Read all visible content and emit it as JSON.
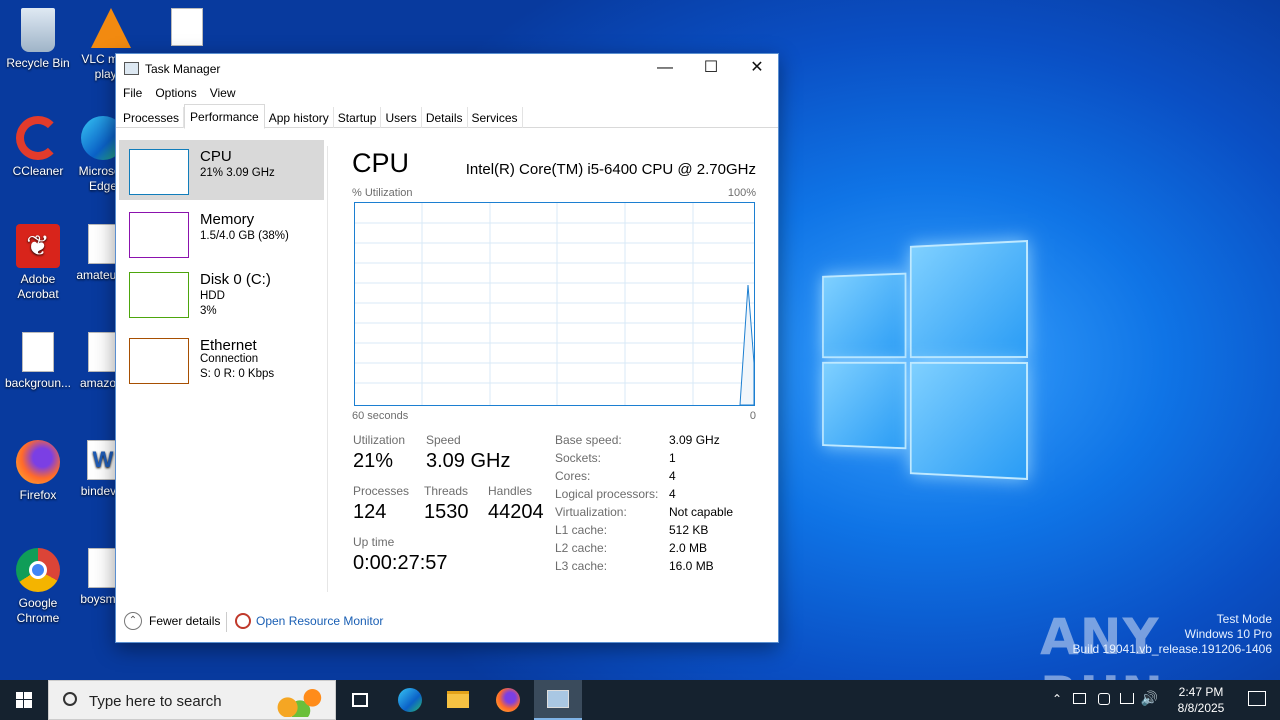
{
  "desktop": {
    "icons": [
      {
        "label": "Recycle Bin",
        "icon": "recycle-bin-icon"
      },
      {
        "label": "VLC media player",
        "icon": "vlc-icon"
      },
      {
        "label": "CCleaner",
        "icon": "ccleaner-icon"
      },
      {
        "label": "Microsoft Edge",
        "icon": "edge-icon"
      },
      {
        "label": "Adobe Acrobat",
        "icon": "acrobat-icon"
      },
      {
        "label": "amateur...",
        "icon": "image-file-icon"
      },
      {
        "label": "backgroun...",
        "icon": "image-file-icon"
      },
      {
        "label": "amazo...",
        "icon": "image-file-icon"
      },
      {
        "label": "Firefox",
        "icon": "firefox-icon"
      },
      {
        "label": "bindev...",
        "icon": "word-doc-icon"
      },
      {
        "label": "Google Chrome",
        "icon": "chrome-icon"
      },
      {
        "label": "boysm...",
        "icon": "image-file-icon"
      }
    ],
    "watermark": {
      "line1": "Test Mode",
      "line2": "Windows 10 Pro",
      "line3": "Build 19041.vb_release.191206-1406"
    },
    "anyrun": "ANY RUN"
  },
  "window": {
    "title": "Task Manager",
    "menu": [
      "File",
      "Options",
      "View"
    ],
    "tabs": [
      "Processes",
      "Performance",
      "App history",
      "Startup",
      "Users",
      "Details",
      "Services"
    ],
    "active_tab": "Performance",
    "left_items": [
      {
        "name": "CPU",
        "sub1": "21% 3.09 GHz",
        "sub2": "",
        "color": "#117dbb",
        "selected": true
      },
      {
        "name": "Memory",
        "sub1": "1.5/4.0 GB (38%)",
        "sub2": "",
        "color": "#8b12ae"
      },
      {
        "name": "Disk 0 (C:)",
        "sub1": "HDD",
        "sub2": "3%",
        "color": "#4da60c"
      },
      {
        "name": "Ethernet",
        "sub1": "Connection",
        "sub2": "S: 0 R: 0 Kbps",
        "color": "#a74f01"
      }
    ],
    "cpu": {
      "title": "CPU",
      "model": "Intel(R) Core(TM) i5-6400 CPU @ 2.70GHz",
      "util_label": "% Utilization",
      "max_label": "100%",
      "time_label": "60 seconds",
      "min_label": "0",
      "utilization_label": "Utilization",
      "utilization": "21%",
      "speed_label": "Speed",
      "speed": "3.09 GHz",
      "processes_label": "Processes",
      "processes": "124",
      "threads_label": "Threads",
      "threads": "1530",
      "handles_label": "Handles",
      "handles": "44204",
      "uptime_label": "Up time",
      "uptime": "0:00:27:57",
      "details": [
        {
          "k": "Base speed:",
          "v": "3.09 GHz"
        },
        {
          "k": "Sockets:",
          "v": "1"
        },
        {
          "k": "Cores:",
          "v": "4"
        },
        {
          "k": "Logical processors:",
          "v": "4"
        },
        {
          "k": "Virtualization:",
          "v": "Not capable"
        },
        {
          "k": "L1 cache:",
          "v": "512 KB"
        },
        {
          "k": "L2 cache:",
          "v": "2.0 MB"
        },
        {
          "k": "L3 cache:",
          "v": "16.0 MB"
        }
      ]
    },
    "footer": {
      "fewer": "Fewer details",
      "monitor": "Open Resource Monitor"
    }
  },
  "taskbar": {
    "search_placeholder": "Type here to search",
    "time": "2:47 PM",
    "date": "8/8/2025"
  }
}
